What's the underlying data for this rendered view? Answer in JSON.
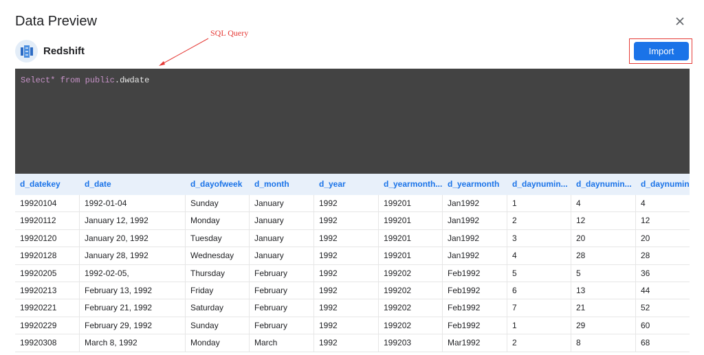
{
  "dialog": {
    "title": "Data Preview",
    "close_icon": "close-icon"
  },
  "source": {
    "name": "Redshift",
    "icon": "database-icon",
    "accent": "#1a73e8"
  },
  "annotation": {
    "label": "SQL Query",
    "color": "#e53935"
  },
  "import_button": {
    "label": "Import",
    "color": "#1a73e8"
  },
  "editor": {
    "select": "Select",
    "star": "*",
    "from": "from",
    "schema": "public",
    "dot": ".",
    "table": "dwdate",
    "background": "#434343"
  },
  "table": {
    "columns": [
      "d_datekey",
      "d_date",
      "d_dayofweek",
      "d_month",
      "d_year",
      "d_yearmonth...",
      "d_yearmonth",
      "d_daynumin...",
      "d_daynumin...",
      "d_daynumin..."
    ],
    "rows": [
      [
        "19920104",
        "1992-01-04",
        "Sunday",
        "January",
        "1992",
        "199201",
        "Jan1992",
        "1",
        "4",
        "4"
      ],
      [
        "19920112",
        "January 12, 1992",
        "Monday",
        "January",
        "1992",
        "199201",
        "Jan1992",
        "2",
        "12",
        "12"
      ],
      [
        "19920120",
        "January 20, 1992",
        "Tuesday",
        "January",
        "1992",
        "199201",
        "Jan1992",
        "3",
        "20",
        "20"
      ],
      [
        "19920128",
        "January 28, 1992",
        "Wednesday",
        "January",
        "1992",
        "199201",
        "Jan1992",
        "4",
        "28",
        "28"
      ],
      [
        "19920205",
        "1992-02-05,",
        "Thursday",
        "February",
        "1992",
        "199202",
        "Feb1992",
        "5",
        "5",
        "36"
      ],
      [
        "19920213",
        "February 13, 1992",
        "Friday",
        "February",
        "1992",
        "199202",
        "Feb1992",
        "6",
        "13",
        "44"
      ],
      [
        "19920221",
        "February 21, 1992",
        "Saturday",
        "February",
        "1992",
        "199202",
        "Feb1992",
        "7",
        "21",
        "52"
      ],
      [
        "19920229",
        "February 29, 1992",
        "Sunday",
        "February",
        "1992",
        "199202",
        "Feb1992",
        "1",
        "29",
        "60"
      ],
      [
        "19920308",
        "March 8, 1992",
        "Monday",
        "March",
        "1992",
        "199203",
        "Mar1992",
        "2",
        "8",
        "68"
      ]
    ]
  }
}
